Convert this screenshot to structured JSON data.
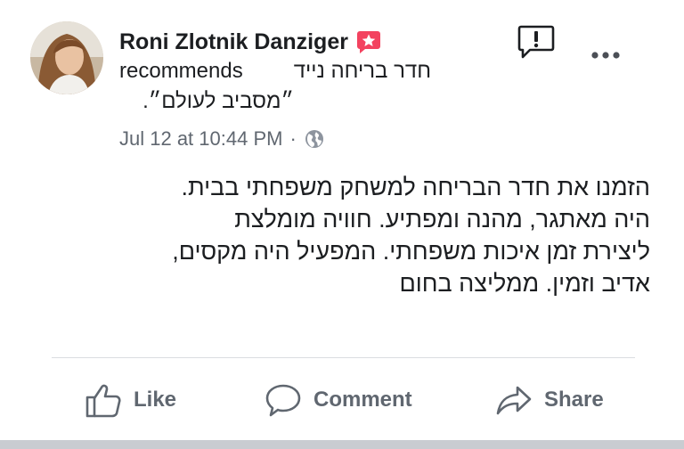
{
  "post": {
    "author_name": "Roni Zlotnik Danziger",
    "recommend_verb": "recommends",
    "page_name_line1": "חדר בריחה נייד",
    "page_name_line2": "״מסביב לעולם״.",
    "timestamp": "Jul 12 at 10:44 PM",
    "meta_separator": "·",
    "audience_icon": "globe-icon",
    "badge_icon": "recommendation-star-icon",
    "body_lines": [
      "הזמנו את חדר הבריחה למשחק משפחתי בבית.",
      "היה מאתגר, מהנה ומפתיע. חוויה מומלצת",
      "ליצירת זמן איכות משפחתי. המפעיל היה מקסים,",
      "אדיב וזמין. ממליצה בחום"
    ]
  },
  "header_actions": {
    "report_icon": "report-icon",
    "more_icon": "more-options-icon"
  },
  "actions": {
    "like_label": "Like",
    "comment_label": "Comment",
    "share_label": "Share"
  },
  "colors": {
    "badge_red": "#f3425f",
    "secondary_text": "#606770",
    "primary_text": "#1c1e21",
    "divider": "#dadde1"
  }
}
